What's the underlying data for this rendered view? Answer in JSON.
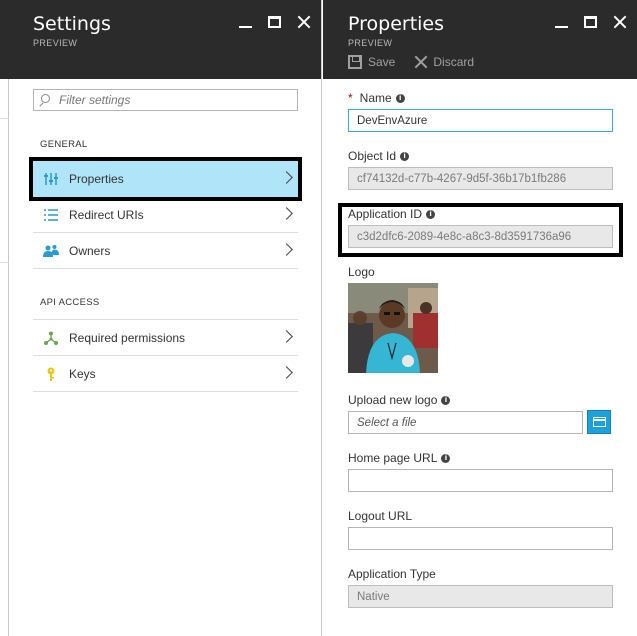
{
  "settings_blade": {
    "title": "Settings",
    "subtitle": "PREVIEW",
    "filter_placeholder": "Filter settings",
    "general_label": "GENERAL",
    "api_access_label": "API ACCESS",
    "general_items": [
      {
        "label": "Properties",
        "icon": "properties-icon",
        "selected": true
      },
      {
        "label": "Redirect URIs",
        "icon": "list-icon",
        "selected": false
      },
      {
        "label": "Owners",
        "icon": "people-icon",
        "selected": false
      }
    ],
    "api_items": [
      {
        "label": "Required permissions",
        "icon": "network-icon"
      },
      {
        "label": "Keys",
        "icon": "key-icon"
      }
    ]
  },
  "properties_blade": {
    "title": "Properties",
    "subtitle": "PREVIEW",
    "save_label": "Save",
    "discard_label": "Discard",
    "name_label": "Name",
    "name_value": "DevEnvAzure",
    "object_id_label": "Object Id",
    "object_id_value": "cf74132d-c77b-4267-9d5f-36b17b1fb286",
    "app_id_label": "Application ID",
    "app_id_value": "c3d2dfc6-2089-4e8c-a8c3-8d3591736a96",
    "logo_label": "Logo",
    "upload_logo_label": "Upload new logo",
    "upload_placeholder": "Select a file",
    "homepage_label": "Home page URL",
    "homepage_value": "",
    "logout_label": "Logout URL",
    "logout_value": "",
    "app_type_label": "Application Type",
    "app_type_value": "Native"
  },
  "colors": {
    "header_bg": "#2b2b2b",
    "selected_bg": "#b0e4f9",
    "accent": "#1da1dc",
    "required": "#cc0000"
  }
}
